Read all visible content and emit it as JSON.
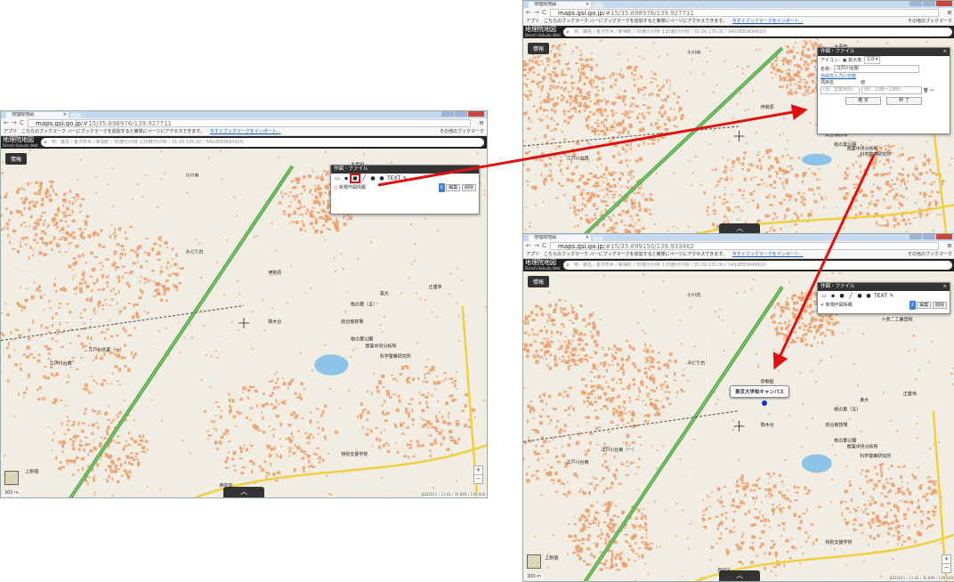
{
  "browser": {
    "tab_title": "地理院地図",
    "tab_close": "×",
    "nav_back": "←",
    "nav_forward": "→",
    "nav_reload": "C",
    "url_host": "maps.gsi.go.jp",
    "bookmarks_apps": "アプリ",
    "bookmarks_message": "こちらのブックマーク バーにブックマークを追加すると簡単にページにアクセスできます。",
    "bookmarks_import": "今すぐブックマークをインポート...",
    "bookmarks_other": "その他のブックマーク",
    "menu_icon": "≡",
    "star_icon": "☆",
    "zoom_icon": "🔍"
  },
  "screens": {
    "left": {
      "url_path": "/#15/35.898976/139.927711"
    },
    "top_right": {
      "url_path": "/#15/35.898976/139.927711"
    },
    "bottom_right": {
      "url_path": "/#15/35.899150/139.933462"
    }
  },
  "gsi": {
    "logo_title": "地理院地図",
    "logo_sub": "Denshi Kokudo Web",
    "search_placeholder": "例：蝶岳 / 金沢市木ノ新保町 / 35度0分0秒 135度0分0秒 / 35.00 135.00 / 54SUE8369492O",
    "info_button": "情報",
    "scale_label": "300 m",
    "attribution": "JGD2011 / 11:42 / 35.899 / 139.928",
    "expand_tab": "︿",
    "zoom_in": "+",
    "zoom_out": "−"
  },
  "panel": {
    "title": "作図・ファイル",
    "close": "×",
    "new_layer": "新規作図情報",
    "count_left": "0",
    "count_right": "2",
    "edit_button": "編集",
    "delete_button": "削除",
    "text_tool": "TEXT",
    "tools": [
      "folder-open-icon",
      "save-icon",
      "marker-icon",
      "polyline-icon",
      "polygon-icon",
      "circle-icon",
      "text-icon",
      "free-draw-icon"
    ]
  },
  "marker_dialog": {
    "title": "作図・ファイル",
    "icon_label": "アイコン：",
    "scale_label": "拡大率:",
    "scale_value": "1.0",
    "name_label": "名称：",
    "name_value": "江戸川台駅",
    "toggle_free_input": "自由文入力に切替",
    "item_name_header": "項目名",
    "value_header": "値",
    "item_name_placeholder": "(例：営業時間)",
    "value_placeholder": "(例：10時～18時)",
    "confirm_button": "確 定",
    "finish_button": "終 了"
  },
  "popup": {
    "text": "東京大学柏キャンパス"
  },
  "map_labels": {
    "l1": "柏の葉（五）",
    "l2": "十余二工業団地",
    "l3": "江戸川台西",
    "l4": "柏の葉公園",
    "l5": "総合競技場",
    "l6": "東大",
    "l7": "関東中央分析所",
    "l8": "科学警察研究所",
    "l9": "大青田",
    "l10": "小川向",
    "l11": "正連寺",
    "l12": "伊勢原",
    "l13": "江戸川台東（一）",
    "l14": "特別支援学校",
    "l15": "西初石",
    "l16": "上新宿",
    "l17": "駒木台",
    "l18": "みどり台"
  },
  "colors": {
    "map_bg": "#f2ede2",
    "building": "#ea9c6a",
    "highway": "#55a84a",
    "arrow": "#e01010",
    "panel_header": "#333333",
    "badge": "#3b7fd6"
  }
}
